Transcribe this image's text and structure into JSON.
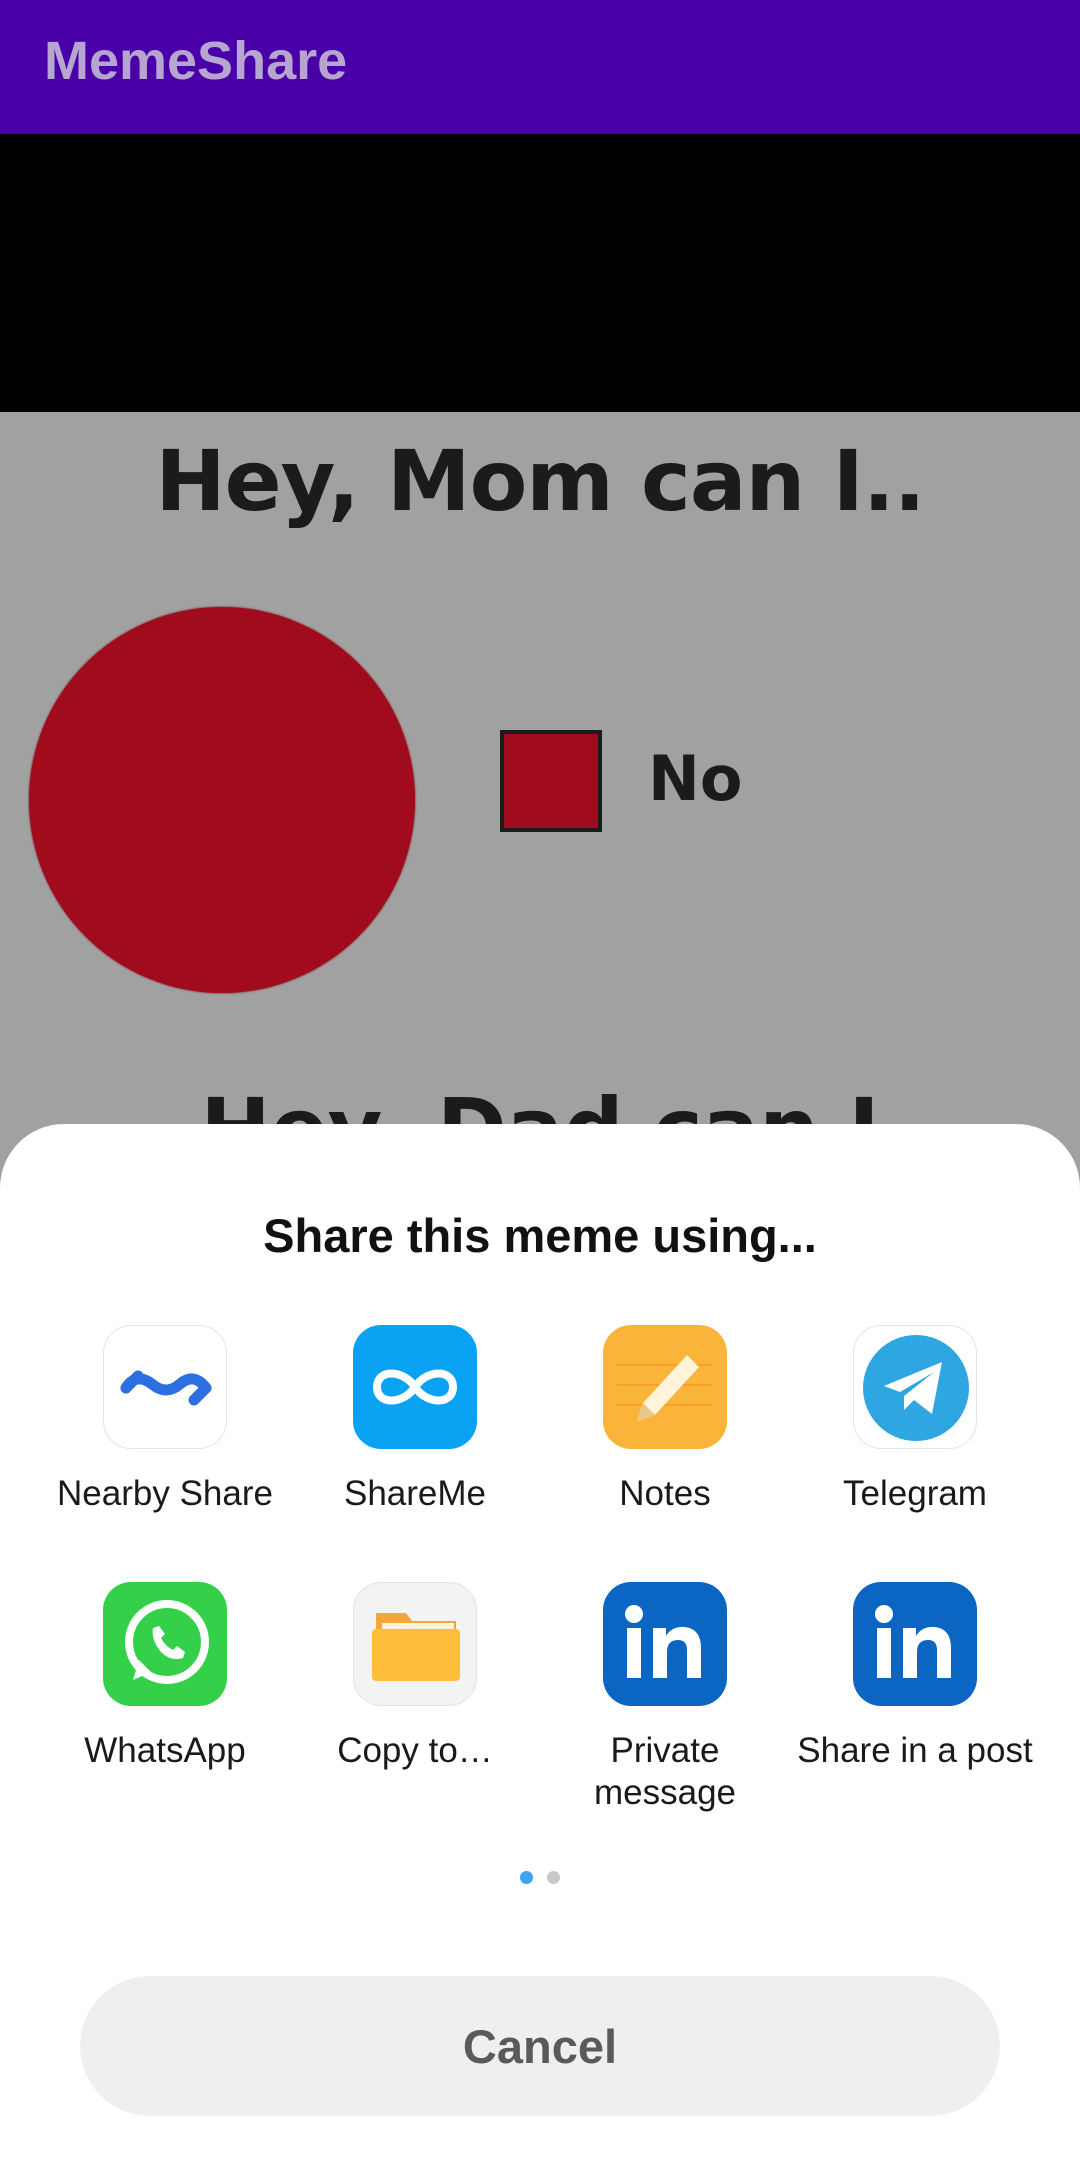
{
  "app": {
    "title": "MemeShare",
    "accent": "#4a00a8"
  },
  "meme": {
    "title": "Hey, Mom can I..",
    "legend_label": "No",
    "subtitle": "Hey, Dad can I",
    "slice_color": "#a00c1e"
  },
  "share_sheet": {
    "title": "Share this meme using...",
    "apps": [
      {
        "label": "Nearby Share",
        "icon": "nearby-share-icon"
      },
      {
        "label": "ShareMe",
        "icon": "shareme-icon"
      },
      {
        "label": "Notes",
        "icon": "notes-icon"
      },
      {
        "label": "Telegram",
        "icon": "telegram-icon"
      },
      {
        "label": "WhatsApp",
        "icon": "whatsapp-icon"
      },
      {
        "label": "Copy to…",
        "icon": "folder-icon"
      },
      {
        "label": "Private message",
        "icon": "linkedin-icon"
      },
      {
        "label": "Share in a post",
        "icon": "linkedin-icon"
      }
    ],
    "page_indicator": {
      "current": 1,
      "total": 2,
      "active_color": "#3fa3f2",
      "inactive_color": "#c8c8c8"
    },
    "cancel_label": "Cancel"
  }
}
